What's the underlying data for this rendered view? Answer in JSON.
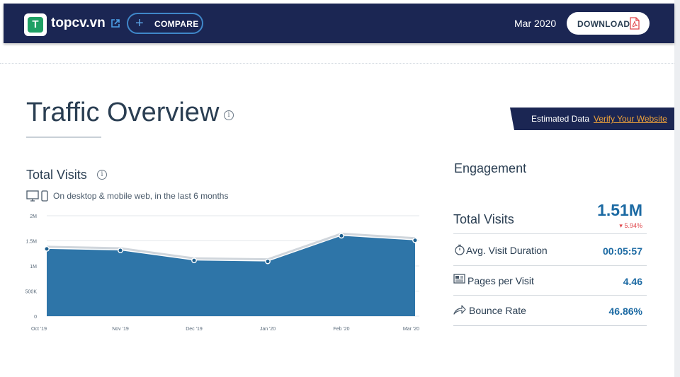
{
  "header": {
    "logo_letter": "T",
    "domain": "topcv.vn",
    "compare_label": "COMPARE",
    "date": "Mar 2020",
    "download_label": "DOWNLOAD"
  },
  "banner": {
    "label": "Estimated Data",
    "link": "Verify Your Website"
  },
  "page": {
    "title": "Traffic Overview"
  },
  "total_visits": {
    "title": "Total Visits",
    "subtitle": "On desktop & mobile web, in the last 6 months"
  },
  "chart_data": {
    "type": "area",
    "x": [
      "Oct '19",
      "Nov '19",
      "Dec '19",
      "Jan '20",
      "Feb '20",
      "Mar '20"
    ],
    "series": [
      {
        "values": [
          1340000,
          1310000,
          1110000,
          1090000,
          1600000,
          1510000
        ]
      }
    ],
    "yticks": [
      {
        "value": 0,
        "label": "0"
      },
      {
        "value": 500000,
        "label": "500K"
      },
      {
        "value": 1000000,
        "label": "1M"
      },
      {
        "value": 1500000,
        "label": "1.5M"
      },
      {
        "value": 2000000,
        "label": "2M"
      }
    ],
    "ylim": [
      0,
      2000000
    ],
    "grid": true,
    "colors": {
      "fill": "#2e75a8",
      "shadow": "#d0d6dc",
      "marker": "#1d5f8e"
    }
  },
  "engagement": {
    "title": "Engagement",
    "total_visits": {
      "label": "Total Visits",
      "value": "1.51M",
      "change": "5.94%"
    },
    "rows": [
      {
        "label": "Avg. Visit Duration",
        "value": "00:05:57"
      },
      {
        "label": "Pages per Visit",
        "value": "4.46"
      },
      {
        "label": "Bounce Rate",
        "value": "46.86%"
      }
    ]
  }
}
